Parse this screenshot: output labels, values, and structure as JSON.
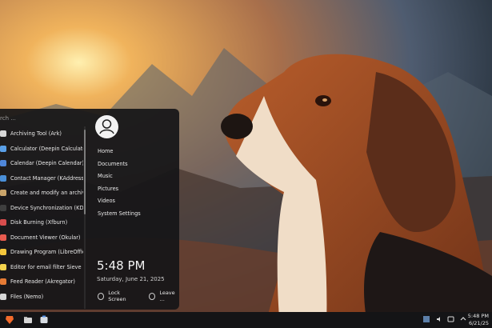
{
  "start_menu": {
    "search_text": "rch ...",
    "apps": [
      {
        "label": "Archiving Tool (Ark)",
        "color": "#d7d7d7"
      },
      {
        "label": "Calculator (Deepin Calculator)",
        "color": "#5aa0e8"
      },
      {
        "label": "Calendar (Deepin Calendar)",
        "color": "#4f87d9"
      },
      {
        "label": "Contact Manager (KAddressBo…",
        "color": "#4a8fd8"
      },
      {
        "label": "Create and modify an archive (…",
        "color": "#c9a46a"
      },
      {
        "label": "Device Synchronization (KDE C…",
        "color": "#3e3e3e"
      },
      {
        "label": "Disk Burning (Xfburn)",
        "color": "#d74d4d"
      },
      {
        "label": "Document Viewer (Okular)",
        "color": "#e75b4f"
      },
      {
        "label": "Drawing Program (LibreOffice …",
        "color": "#f4c63c"
      },
      {
        "label": "Editor for email filter Sieve scri…",
        "color": "#f5d34d"
      },
      {
        "label": "Feed Reader (Akregator)",
        "color": "#e67b35"
      },
      {
        "label": "Files (Nemo)",
        "color": "#d6d6d6"
      }
    ],
    "places": [
      "Home",
      "Documents",
      "Music",
      "Pictures",
      "Videos",
      "System Settings"
    ],
    "time": "5:48 PM",
    "date": "Saturday, June 21, 2025",
    "lock_label": "Lock Screen",
    "leave_label": "Leave …"
  },
  "taskbar": {
    "clock_time": "5:48 PM",
    "clock_date": "6/21/25"
  }
}
